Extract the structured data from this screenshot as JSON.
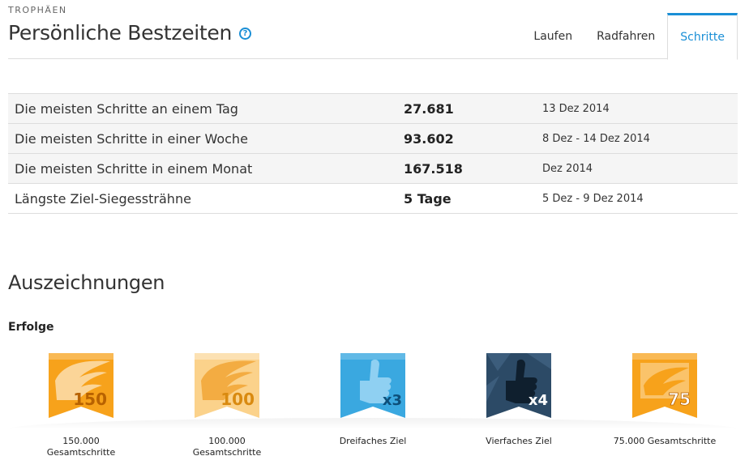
{
  "header": {
    "eyebrow": "TROPHÄEN",
    "title": "Persönliche Bestzeiten",
    "tabs": [
      {
        "label": "Laufen",
        "active": false
      },
      {
        "label": "Radfahren",
        "active": false
      },
      {
        "label": "Schritte",
        "active": true
      }
    ]
  },
  "records": [
    {
      "label": "Die meisten Schritte an einem Tag",
      "value": "27.681",
      "date": "13 Dez 2014"
    },
    {
      "label": "Die meisten Schritte in einer Woche",
      "value": "93.602",
      "date": "8 Dez - 14 Dez 2014"
    },
    {
      "label": "Die meisten Schritte in einem Monat",
      "value": "167.518",
      "date": "Dez 2014"
    },
    {
      "label": "Längste Ziel-Siegessträhne",
      "value": "5 Tage",
      "date": "5 Dez - 9 Dez 2014"
    }
  ],
  "awards": {
    "title": "Auszeichnungen",
    "section": "Erfolge",
    "badges": [
      {
        "label": "150.000 Gesamtschritte",
        "number": "150",
        "icon": "wing-badge-icon",
        "color": "#f7a21b"
      },
      {
        "label": "100.000 Gesamtschritte",
        "number": "100",
        "icon": "wing-badge-icon",
        "color": "#fbd28b"
      },
      {
        "label": "Dreifaches Ziel",
        "number": "x3",
        "icon": "thumbs-up-badge-icon",
        "color": "#3aa8e0"
      },
      {
        "label": "Vierfaches Ziel",
        "number": "x4",
        "icon": "thumbs-up-badge-icon",
        "color": "#2c4a66"
      },
      {
        "label": "75.000 Gesamtschritte",
        "number": "75",
        "icon": "wing-badge-icon",
        "color": "#f7a21b"
      }
    ]
  },
  "colors": {
    "accent": "#1a8fd6",
    "border": "#dddddd",
    "row_shade": "#f5f5f5"
  }
}
